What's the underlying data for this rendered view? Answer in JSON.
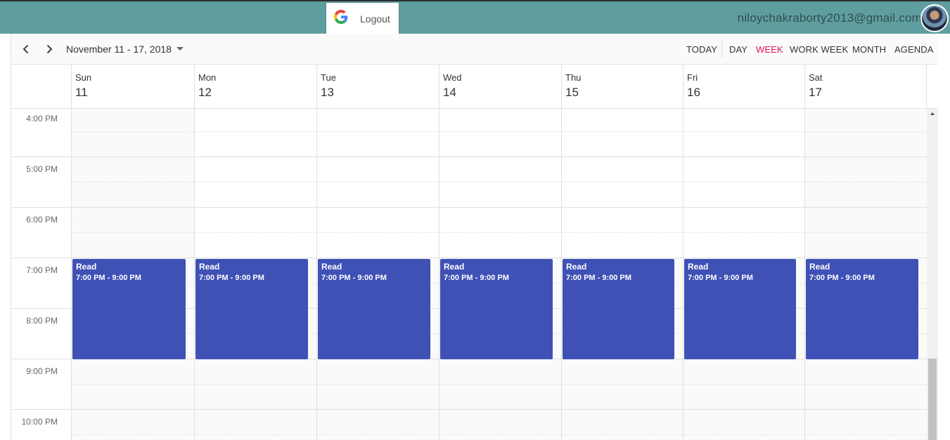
{
  "header": {
    "logout_label": "Logout",
    "user_email": "niloychakraborty2013@gmail.com",
    "bar_color": "#5f9ea0"
  },
  "toolbar": {
    "date_range": "November 11 - 17, 2018",
    "views": [
      {
        "label": "TODAY",
        "active": false
      },
      {
        "label": "DAY",
        "active": false
      },
      {
        "label": "WEEK",
        "active": true
      },
      {
        "label": "WORK WEEK",
        "active": false
      },
      {
        "label": "MONTH",
        "active": false
      },
      {
        "label": "AGENDA",
        "active": false
      }
    ],
    "active_color": "#e3165b"
  },
  "days": [
    {
      "name": "Sun",
      "num": "11"
    },
    {
      "name": "Mon",
      "num": "12"
    },
    {
      "name": "Tue",
      "num": "13"
    },
    {
      "name": "Wed",
      "num": "14"
    },
    {
      "name": "Thu",
      "num": "15"
    },
    {
      "name": "Fri",
      "num": "16"
    },
    {
      "name": "Sat",
      "num": "17"
    }
  ],
  "times": [
    "4:00 PM",
    "5:00 PM",
    "6:00 PM",
    "7:00 PM",
    "8:00 PM",
    "9:00 PM",
    "10:00 PM"
  ],
  "events": [
    {
      "title": "Read",
      "time": "7:00 PM - 9:00 PM"
    },
    {
      "title": "Read",
      "time": "7:00 PM - 9:00 PM"
    },
    {
      "title": "Read",
      "time": "7:00 PM - 9:00 PM"
    },
    {
      "title": "Read",
      "time": "7:00 PM - 9:00 PM"
    },
    {
      "title": "Read",
      "time": "7:00 PM - 9:00 PM"
    },
    {
      "title": "Read",
      "time": "7:00 PM - 9:00 PM"
    },
    {
      "title": "Read",
      "time": "7:00 PM - 9:00 PM"
    }
  ],
  "event_color": "#3f51b5"
}
